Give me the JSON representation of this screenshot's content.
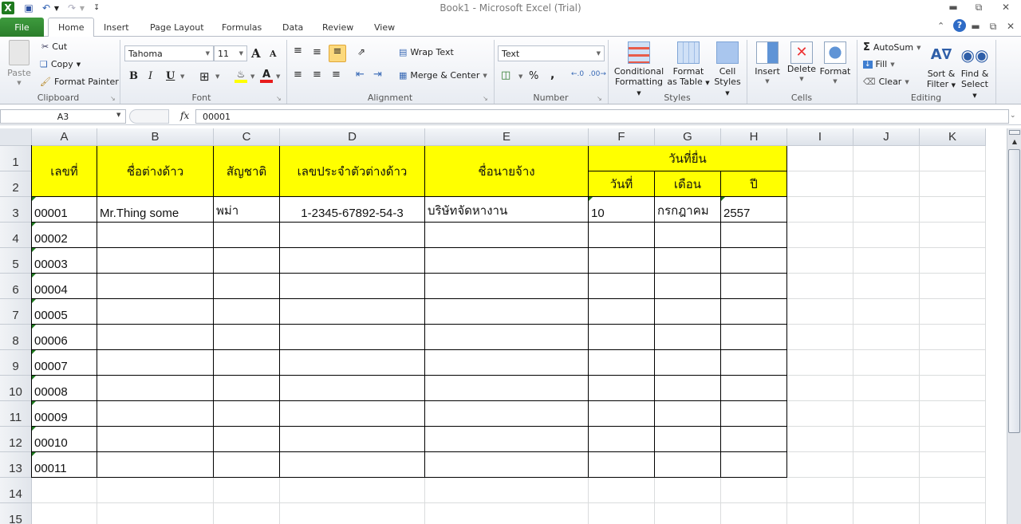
{
  "window": {
    "title": "Book1  -  Microsoft Excel (Trial)"
  },
  "quick_access": {
    "save": "save-icon",
    "undo": "undo-icon",
    "redo": "redo-icon",
    "customize": "customize-icon"
  },
  "tabs": [
    "File",
    "Home",
    "Insert",
    "Page Layout",
    "Formulas",
    "Data",
    "Review",
    "View"
  ],
  "active_tab": "Home",
  "ribbon": {
    "clipboard": {
      "label": "Clipboard",
      "paste": "Paste",
      "cut": "Cut",
      "copy": "Copy",
      "format_painter": "Format Painter"
    },
    "font": {
      "label": "Font",
      "name": "Tahoma",
      "size": "11",
      "bold": "B",
      "italic": "I",
      "underline": "U",
      "grow": "A",
      "shrink": "A",
      "font_color": "#e81c1c",
      "fill_color": "#ffff00"
    },
    "alignment": {
      "label": "Alignment",
      "wrap_text": "Wrap Text",
      "merge_center": "Merge & Center"
    },
    "number": {
      "label": "Number",
      "format": "Text",
      "percent": "%",
      "comma": ","
    },
    "styles": {
      "label": "Styles",
      "conditional": [
        "Conditional",
        "Formatting"
      ],
      "format_table": [
        "Format",
        "as Table"
      ],
      "cell_styles": [
        "Cell",
        "Styles"
      ]
    },
    "cells": {
      "label": "Cells",
      "insert": "Insert",
      "delete": "Delete",
      "format": "Format"
    },
    "editing": {
      "label": "Editing",
      "autosum": "AutoSum",
      "fill": "Fill",
      "clear": "Clear",
      "sort_filter": [
        "Sort &",
        "Filter"
      ],
      "find_select": [
        "Find &",
        "Select"
      ]
    }
  },
  "formula_bar": {
    "name_box": "A3",
    "fx": "fx",
    "value": "00001"
  },
  "columns": [
    "A",
    "B",
    "C",
    "D",
    "E",
    "F",
    "G",
    "H",
    "I",
    "J",
    "K"
  ],
  "rows": [
    "1",
    "2",
    "3",
    "4",
    "5",
    "6",
    "7",
    "8",
    "9",
    "10",
    "11",
    "12",
    "13",
    "14",
    "15"
  ],
  "sheet": {
    "headers": {
      "A": "เลขที่",
      "B": "ชื่อต่างด้าว",
      "C": "สัญชาติ",
      "D": "เลขประจำตัวต่างด้าว",
      "E": "ชื่อนายจ้าง",
      "FGH": "วันที่ยื่น",
      "F": "วันที่",
      "G": "เดือน",
      "H": "ปี"
    },
    "row3": {
      "A": "00001",
      "B": "Mr.Thing  some",
      "C": "พม่า",
      "D": "1-2345-67892-54-3",
      "E": "บริษัทจัดหางาน",
      "F": "10",
      "G": "กรกฎาคม",
      "H": "2557"
    },
    "col_a_values": [
      "00002",
      "00003",
      "00004",
      "00005",
      "00006",
      "00007",
      "00008",
      "00009",
      "00010",
      "00011"
    ]
  }
}
